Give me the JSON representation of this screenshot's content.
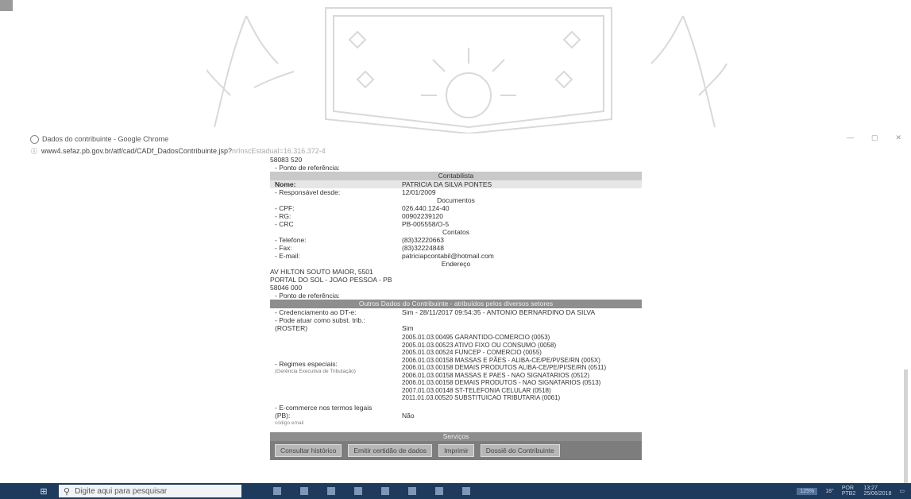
{
  "browser": {
    "window_title": "Dados do contribuinte - Google Chrome",
    "url_main": "www4.sefaz.pb.gov.br/atf/cad/CADf_DadosContribuinte.jsp?",
    "url_faded": "nrInscEstadual=16.316.372-4"
  },
  "top": {
    "cep": "58083 520",
    "ponto_label": "- Ponto de referência:"
  },
  "contribuinte": {
    "header": "Contabilista",
    "nome_label": "Nome:",
    "nome_value": "PATRICIA DA SILVA PONTES",
    "resp_label": "- Responsável desde:",
    "resp_value": "12/01/2009",
    "doc_header": "Documentos",
    "cpf_label": "- CPF:",
    "cpf_value": "026.440.124-40",
    "rg_label": "- RG:",
    "rg_value": "00902239120",
    "crc_label": "- CRC",
    "crc_value": "PB-005558/O-5",
    "contatos_header": "Contatos",
    "tel_label": "- Telefone:",
    "tel_value": "(83)32220663",
    "fax_label": "- Fax:",
    "fax_value": "(83)32224848",
    "email_label": "- E-mail:",
    "email_value": "patriciapcontabil@hotmail.com",
    "endereco_header": "Endereço",
    "end_line1": "AV HILTON SOUTO MAIOR, 5501",
    "end_line2": "PORTAL DO SOL - JOAO PESSOA - PB",
    "end_line3": "58046 000",
    "ponto2_label": "- Ponto de referência:"
  },
  "outros": {
    "header": "Outros Dados do Contribuinte - atribuídos pelos diversos setores",
    "cred_label": "- Credenciamento ao DT-e:",
    "cred_value": "Sim - 28/11/2017 09:54:35 - ANTONIO BERNARDINO DA SILVA",
    "subst_label": "- Pode atuar como subst. trib.:",
    "subst_label2": "(ROSTER)",
    "subst_value": "Sim",
    "regimes_label": "- Regimes especiais:",
    "regimes_sub": "(Gerência Executiva de Tributação)",
    "regimes": [
      "2005.01.03.00495 GARANTIDO-COMERCIO (0053)",
      "2005.01.03.00523 ATIVO FIXO OU CONSUMO (0058)",
      "2005.01.03.00524 FUNCEP - COMERCIO (0055)",
      "2006.01.03.00158 MASSAS E PÃES - ALIBA-CE/PE/PI/SE/RN (005X)",
      "2006.01.03.00158 DEMAIS PRODUTOS ALIBA-CE/PE/PI/SE/RN (0511)",
      "2006.01.03.00158 MASSAS E PAES - NAO SIGNATARIOS (0512)",
      "2006.01.03.00158 DEMAIS PRODUTOS - NAO SIGNATARIOS (0513)",
      "2007.01.03.00148 ST-TELEFONIA CELULAR (0518)",
      "2011.01.03.00520 SUBSTITUICAO TRIBUTARIA (0061)"
    ],
    "ecom_label": "- E-commerce nos termos legais",
    "ecom_label2": "(PB):",
    "ecom_label3": "código email",
    "ecom_value": "Não"
  },
  "servicos": {
    "header": "Serviços",
    "buttons": [
      "Consultar histórico",
      "Emitir certidão de dados",
      "Imprimir",
      "Dossiê do Contribuinte"
    ]
  },
  "taskbar": {
    "search_placeholder": "Digite aqui para pesquisar",
    "zoom": "125%",
    "lang": "POR",
    "lang2": "PTB2",
    "time": "13:27",
    "date": "25/06/2018",
    "temp": "18°"
  }
}
